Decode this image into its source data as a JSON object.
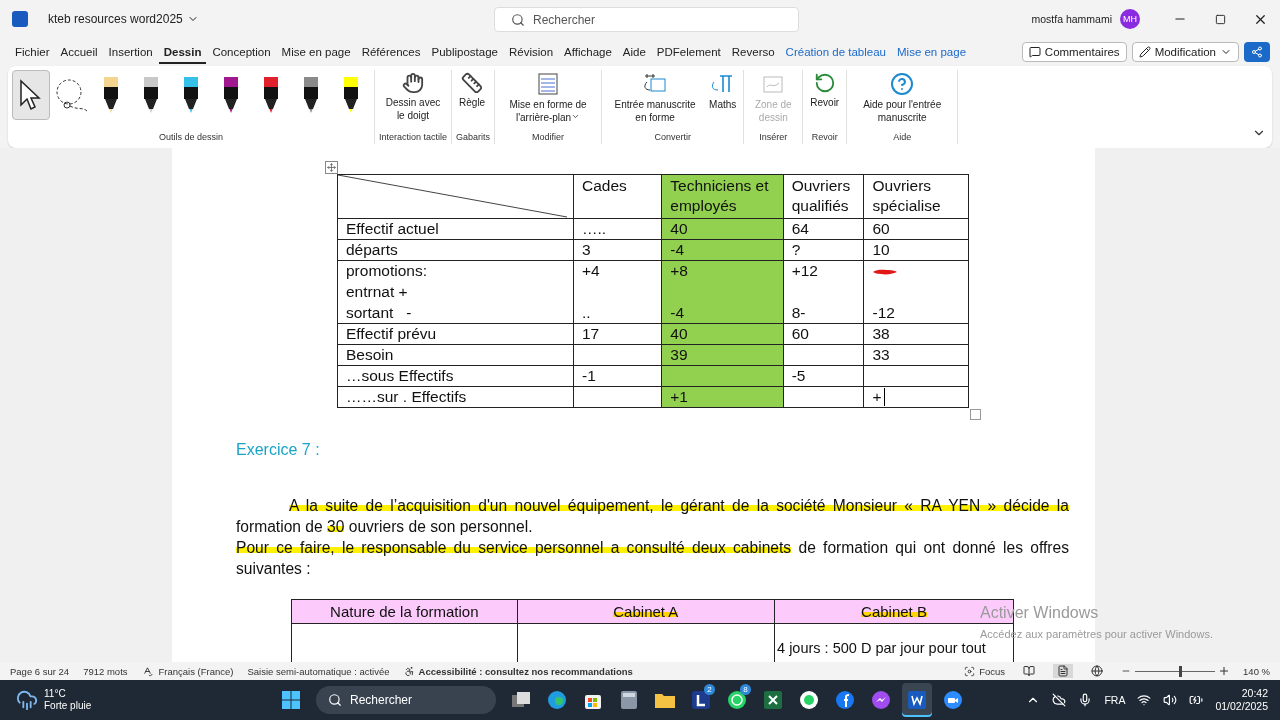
{
  "title_bar": {
    "document": "kteb resources word2025",
    "search_placeholder": "Rechercher",
    "user": "mostfa hammami",
    "initials": "MH"
  },
  "menu": [
    {
      "label": "Fichier",
      "selected": false,
      "kind": "tab"
    },
    {
      "label": "Accueil",
      "selected": false,
      "kind": "tab"
    },
    {
      "label": "Insertion",
      "selected": false,
      "kind": "tab"
    },
    {
      "label": "Dessin",
      "selected": true,
      "kind": "tab"
    },
    {
      "label": "Conception",
      "selected": false,
      "kind": "tab"
    },
    {
      "label": "Mise en page",
      "selected": false,
      "kind": "tab"
    },
    {
      "label": "Références",
      "selected": false,
      "kind": "tab"
    },
    {
      "label": "Publipostage",
      "selected": false,
      "kind": "tab"
    },
    {
      "label": "Révision",
      "selected": false,
      "kind": "tab"
    },
    {
      "label": "Affichage",
      "selected": false,
      "kind": "tab"
    },
    {
      "label": "Aide",
      "selected": false,
      "kind": "tab"
    },
    {
      "label": "PDFelement",
      "selected": false,
      "kind": "tab"
    },
    {
      "label": "Reverso",
      "selected": false,
      "kind": "tab"
    },
    {
      "label": "Création de tableau",
      "selected": false,
      "kind": "contextual"
    },
    {
      "label": "Mise en page",
      "selected": false,
      "kind": "contextual"
    }
  ],
  "menu_actions": {
    "comments": "Commentaires",
    "mode": "Modification"
  },
  "ribbon": [
    {
      "label": "Outils de dessin",
      "tools": [
        {
          "kind": "select",
          "selected": true
        },
        {
          "kind": "lasso",
          "selected": false
        },
        {
          "kind": "pen",
          "selected": false,
          "color": "#f3d58f"
        },
        {
          "kind": "pen",
          "selected": false,
          "color": "#c8c8c8"
        },
        {
          "kind": "pen",
          "selected": false,
          "color": "#35c0ea"
        },
        {
          "kind": "pen",
          "selected": false,
          "color": "#a0178f"
        },
        {
          "kind": "pen",
          "selected": false,
          "color": "#e0202a"
        },
        {
          "kind": "pen",
          "selected": false,
          "color": "#8a8a8a"
        },
        {
          "kind": "pen",
          "selected": false,
          "color": "#ffff00"
        }
      ]
    },
    {
      "label": "Interaction tactile",
      "items": [
        {
          "kind": "finger",
          "label": "Dessin avec le doigt",
          "disabled": false
        }
      ]
    },
    {
      "label": "Gabarits",
      "items": [
        {
          "kind": "ruler",
          "label": "Règle",
          "disabled": false
        }
      ]
    },
    {
      "label": "Modifier",
      "items": [
        {
          "kind": "background",
          "label": "Mise en forme de l'arrière-plan",
          "disabled": false,
          "dropdown": true
        }
      ]
    },
    {
      "label": "Convertir",
      "items": [
        {
          "kind": "ink-shape",
          "label": "Entrée manuscrite en forme",
          "disabled": false
        },
        {
          "kind": "math",
          "label": "Maths",
          "disabled": false
        }
      ]
    },
    {
      "label": "Insérer",
      "items": [
        {
          "kind": "canvas",
          "label": "Zone de dessin",
          "disabled": true
        }
      ]
    },
    {
      "label": "Revoir",
      "items": [
        {
          "kind": "replay",
          "label": "Revoir",
          "disabled": false
        }
      ]
    },
    {
      "label": "Aide",
      "items": [
        {
          "kind": "help",
          "label": "Aide pour l'entrée manuscrite",
          "disabled": false
        }
      ]
    }
  ],
  "table": {
    "columns": [
      {
        "kind": "diagonal",
        "highlighted": false
      },
      {
        "kind": "text",
        "label": "Cades",
        "highlighted": false
      },
      {
        "kind": "text",
        "label": "Techniciens et employés",
        "highlighted": true
      },
      {
        "kind": "text",
        "label": "Ouvriers qualifiés",
        "highlighted": false
      },
      {
        "kind": "text",
        "label": "Ouvriers spécialise",
        "highlighted": false
      }
    ],
    "rows": [
      {
        "tall": false,
        "cells": [
          {
            "lines": [
              "Effectif actuel"
            ]
          },
          {
            "lines": [
              "….."
            ]
          },
          {
            "lines": [
              "40"
            ]
          },
          {
            "lines": [
              "64"
            ]
          },
          {
            "lines": [
              "60"
            ]
          }
        ]
      },
      {
        "tall": false,
        "cells": [
          {
            "lines": [
              "départs"
            ]
          },
          {
            "lines": [
              "3"
            ]
          },
          {
            "lines": [
              "-4"
            ]
          },
          {
            "lines": [
              "?"
            ]
          },
          {
            "lines": [
              "10"
            ]
          }
        ]
      },
      {
        "tall": true,
        "cells": [
          {
            "lines": [
              "promotions:",
              "entrnat +",
              "sortant   -"
            ]
          },
          {
            "lines": [
              "+4",
              ".."
            ]
          },
          {
            "lines": [
              "+8",
              "-4"
            ]
          },
          {
            "lines": [
              "+12",
              "8-"
            ]
          },
          {
            "lines": [
              "-12"
            ],
            "scribble": true
          }
        ]
      },
      {
        "tall": false,
        "cells": [
          {
            "lines": [
              "Effectif prévu"
            ]
          },
          {
            "lines": [
              "17"
            ]
          },
          {
            "lines": [
              "40"
            ]
          },
          {
            "lines": [
              "60"
            ]
          },
          {
            "lines": [
              "38"
            ]
          }
        ]
      },
      {
        "tall": false,
        "cells": [
          {
            "lines": [
              "Besoin"
            ]
          },
          {},
          {
            "lines": [
              "39"
            ]
          },
          {},
          {
            "lines": [
              "33"
            ]
          }
        ]
      },
      {
        "tall": false,
        "cells": [
          {
            "lines": [
              "…sous Effectifs"
            ]
          },
          {
            "lines": [
              "-1"
            ]
          },
          {},
          {
            "lines": [
              "-5"
            ]
          },
          {}
        ]
      },
      {
        "tall": false,
        "cells": [
          {
            "lines": [
              "……sur . Effectifs"
            ]
          },
          {},
          {
            "lines": [
              "+1"
            ]
          },
          {},
          {
            "lines": [
              "+"
            ],
            "cursor": true
          }
        ]
      }
    ]
  },
  "exercise_title": "Exercice 7 :",
  "paragraphs": [
    {
      "indent": true,
      "segments": [
        {
          "text": "A la suite de l’acquisition d'un nouvel équipement, le gérant de la société Monsieur « RA YEN » décide la",
          "highlighted": true
        },
        {
          "text": " formation de ",
          "highlighted": false
        },
        {
          "text": "30",
          "highlighted": true
        },
        {
          "text": " ouvriers de son personnel.",
          "highlighted": false
        }
      ]
    },
    {
      "indent": false,
      "segments": [
        {
          "text": "Pour ce faire, le responsable du service personnel a consulté deux cabinets",
          "highlighted": true
        },
        {
          "text": " de formation qui ont donné les offres suivantes :",
          "highlighted": false
        }
      ]
    }
  ],
  "offers_table": {
    "columns": [
      {
        "label": "Nature de la formation",
        "highlighted": false
      },
      {
        "label": "Cabinet A",
        "highlighted": true
      },
      {
        "label": "Cabinet B",
        "highlighted": true
      }
    ],
    "rows": [
      {
        "cells": [
          {},
          {},
          {
            "text": "4 jours : 500 D par jour pour tout"
          }
        ]
      }
    ]
  },
  "activation": {
    "title": "Activer Windows",
    "subtitle": "Accédez aux paramètres pour activer Windows."
  },
  "status_bar": {
    "page": "Page 6 sur 24",
    "words": "7912 mots",
    "language": "Français (France)",
    "autocomplete": "Saisie semi-automatique : activée",
    "accessibility": "Accessibilité : consultez nos recommandations",
    "focus": "Focus",
    "zoom": "140 %",
    "zoom_level": {
      "level": 0.55
    }
  },
  "taskbar": {
    "temperature": "11°C",
    "weather": "Forte pluie",
    "search_placeholder": "Rechercher",
    "apps": [
      {
        "kind": "taskview",
        "selected": false
      },
      {
        "kind": "edge",
        "selected": false
      },
      {
        "kind": "store",
        "selected": false
      },
      {
        "kind": "calculator",
        "selected": false
      },
      {
        "kind": "folder",
        "selected": false
      },
      {
        "kind": "lapp",
        "selected": false,
        "badge": "2"
      },
      {
        "kind": "whatsapp",
        "selected": false,
        "badge": "8"
      },
      {
        "kind": "excel",
        "selected": false
      },
      {
        "kind": "chat",
        "selected": false
      },
      {
        "kind": "facebook",
        "selected": false
      },
      {
        "kind": "messenger",
        "selected": false
      },
      {
        "kind": "word",
        "selected": true
      },
      {
        "kind": "zoom",
        "selected": false
      }
    ],
    "language": "FRA",
    "time": "20:42",
    "date": "01/02/2025"
  }
}
